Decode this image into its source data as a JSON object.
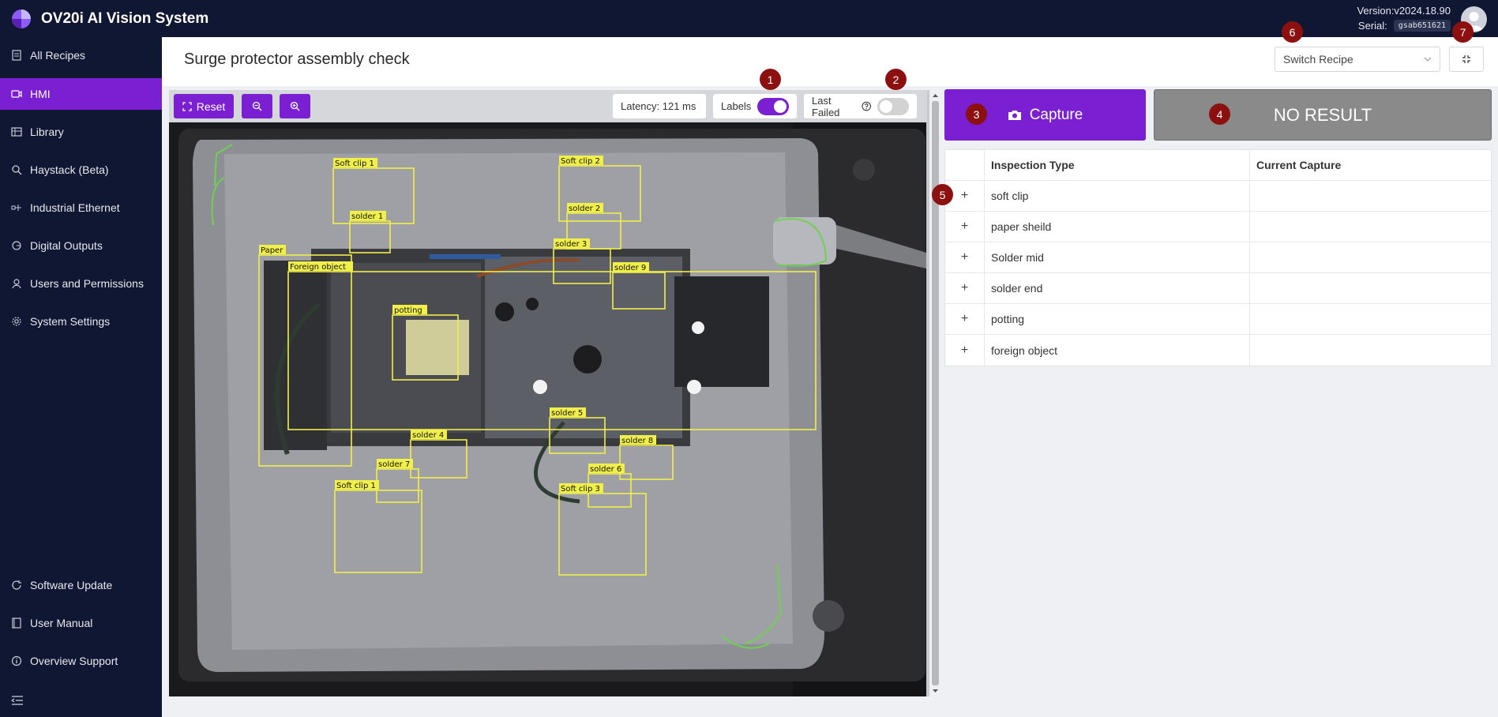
{
  "app": {
    "title": "OV20i AI Vision System",
    "version": "Version:v2024.18.90",
    "serial_label": "Serial:",
    "serial_value": "gsab651621"
  },
  "sidebar": {
    "items": [
      {
        "label": "All Recipes",
        "icon": "document-icon"
      },
      {
        "label": "HMI",
        "icon": "video-icon",
        "active": true
      },
      {
        "label": "Library",
        "icon": "table-icon"
      },
      {
        "label": "Haystack (Beta)",
        "icon": "search-icon"
      },
      {
        "label": "Industrial Ethernet",
        "icon": "network-icon"
      },
      {
        "label": "Digital Outputs",
        "icon": "output-icon"
      },
      {
        "label": "Users and Permissions",
        "icon": "user-icon"
      },
      {
        "label": "System Settings",
        "icon": "gear-icon"
      }
    ],
    "bottom_items": [
      {
        "label": "Software Update",
        "icon": "refresh-icon"
      },
      {
        "label": "User Manual",
        "icon": "book-icon"
      },
      {
        "label": "Overview Support",
        "icon": "info-icon"
      }
    ]
  },
  "header": {
    "page_title": "Surge protector assembly check",
    "switch_recipe_placeholder": "Switch Recipe"
  },
  "toolbar": {
    "reset_label": "Reset",
    "latency": "Latency: 121 ms",
    "labels_label": "Labels",
    "labels_on": true,
    "last_failed_label": "Last Failed",
    "last_failed_on": false
  },
  "camera": {
    "detections": [
      "Soft clip 1",
      "Soft clip 2",
      "solder 1",
      "solder 2",
      "solder 3",
      "solder 9",
      "Paper",
      "Foreign object",
      "potting",
      "solder 5",
      "solder 4",
      "solder 8",
      "solder 7",
      "solder 6",
      "Soft clip 1",
      "Soft clip 3"
    ]
  },
  "capture": {
    "label": "Capture",
    "result": "NO RESULT"
  },
  "table": {
    "headers": [
      "Inspection Type",
      "Current Capture"
    ],
    "rows": [
      {
        "type": "soft clip",
        "capture": ""
      },
      {
        "type": "paper sheild",
        "capture": ""
      },
      {
        "type": "Solder mid",
        "capture": ""
      },
      {
        "type": "solder end",
        "capture": ""
      },
      {
        "type": "potting",
        "capture": ""
      },
      {
        "type": "foreign object",
        "capture": ""
      }
    ]
  },
  "badges": [
    "1",
    "2",
    "3",
    "4",
    "5",
    "6",
    "7"
  ],
  "colors": {
    "accent": "#7a1fd1",
    "nav_bg": "#0f1733",
    "badge": "#8c1010",
    "detection_box": "#f1ef4a",
    "outline_green": "#6fd14f"
  }
}
